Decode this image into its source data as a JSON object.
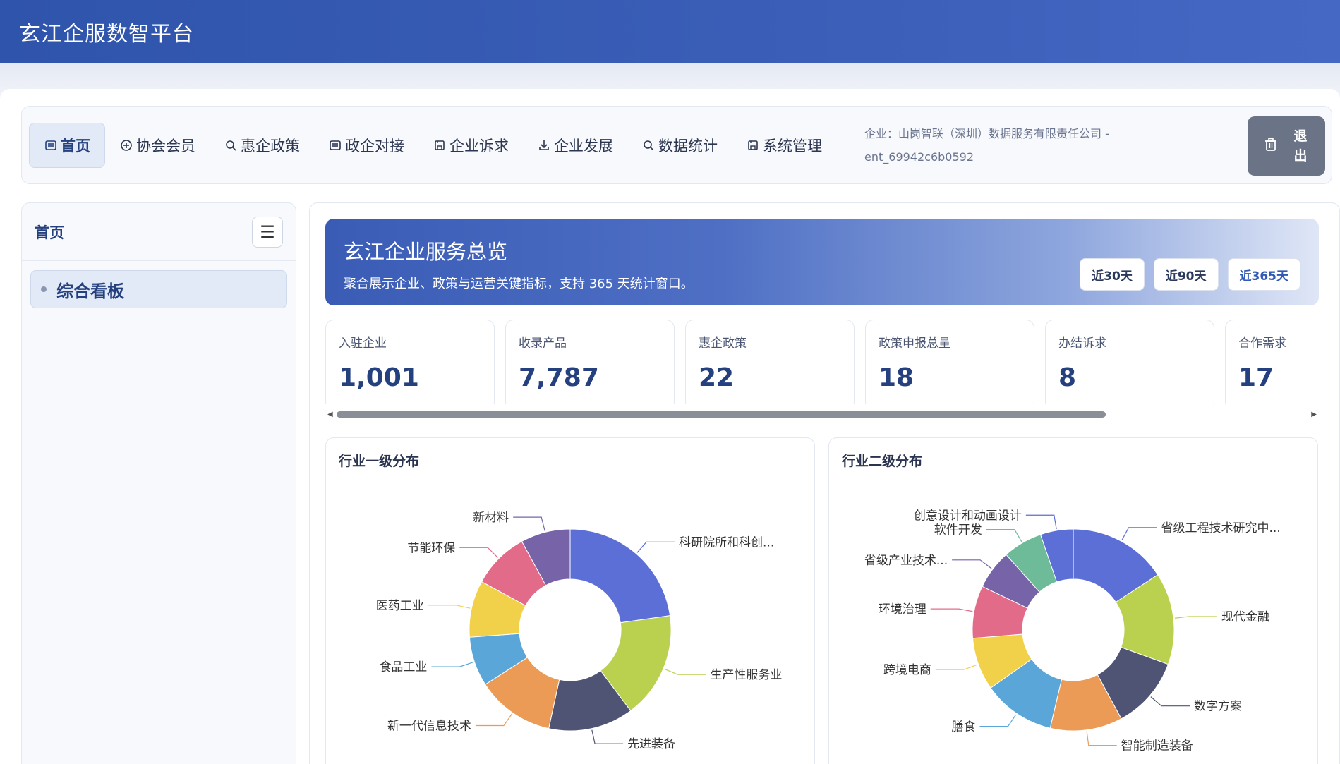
{
  "header": {
    "title": "玄江企服数智平台"
  },
  "nav": {
    "items": [
      {
        "label": "首页",
        "icon": "document-icon"
      },
      {
        "label": "协会会员",
        "icon": "plus-circle-icon"
      },
      {
        "label": "惠企政策",
        "icon": "search-icon"
      },
      {
        "label": "政企对接",
        "icon": "document-icon"
      },
      {
        "label": "企业诉求",
        "icon": "save-icon"
      },
      {
        "label": "企业发展",
        "icon": "download-icon"
      },
      {
        "label": "数据统计",
        "icon": "search-icon"
      },
      {
        "label": "系统管理",
        "icon": "save-icon"
      }
    ],
    "company_line1": "企业：山岗智联（深圳）数据服务有限责任公司 -",
    "company_line2": "ent_69942c6b0592",
    "logout_label": "退出"
  },
  "sidebar": {
    "title": "首页",
    "items": [
      {
        "label": "综合看板"
      }
    ]
  },
  "hero": {
    "title": "玄江企业服务总览",
    "subtitle": "聚合展示企业、政策与运营关键指标，支持 365 天统计窗口。",
    "ranges": [
      "近30天",
      "近90天",
      "近365天"
    ],
    "selected_range": "近365天"
  },
  "stats": [
    {
      "label": "入驻企业",
      "value": "1,001"
    },
    {
      "label": "收录产品",
      "value": "7,787"
    },
    {
      "label": "惠企政策",
      "value": "22"
    },
    {
      "label": "政策申报总量",
      "value": "18"
    },
    {
      "label": "办结诉求",
      "value": "8"
    },
    {
      "label": "合作需求",
      "value": "17"
    }
  ],
  "chart_data": [
    {
      "type": "pie",
      "title": "行业一级分布",
      "categories": [
        "科研院所和科创...",
        "生产性服务业",
        "先进装备",
        "新一代信息技术",
        "食品工业",
        "医药工业",
        "节能环保",
        "新材料"
      ],
      "values": [
        20,
        15,
        12,
        11,
        7,
        8,
        8,
        7
      ],
      "colors": [
        "#5b6fd6",
        "#b9d14f",
        "#4f5474",
        "#ec9b57",
        "#5aa6d9",
        "#f2d14a",
        "#e36b8a",
        "#7763a8"
      ]
    },
    {
      "type": "pie",
      "title": "行业二级分布",
      "categories": [
        "省级工程技术研究中...",
        "现代金融",
        "数字方案",
        "智能制造装备",
        "膳食",
        "跨境电商",
        "环境治理",
        "省级产业技术...",
        "软件开发",
        "创意设计和动画设计"
      ],
      "values": [
        15,
        14,
        11,
        11,
        11,
        8,
        8,
        6,
        6,
        5
      ],
      "colors": [
        "#5b6fd6",
        "#b9d14f",
        "#4f5474",
        "#ec9b57",
        "#5aa6d9",
        "#f2d14a",
        "#e36b8a",
        "#7763a8",
        "#6dbb98",
        "#5b6fd6"
      ]
    }
  ]
}
